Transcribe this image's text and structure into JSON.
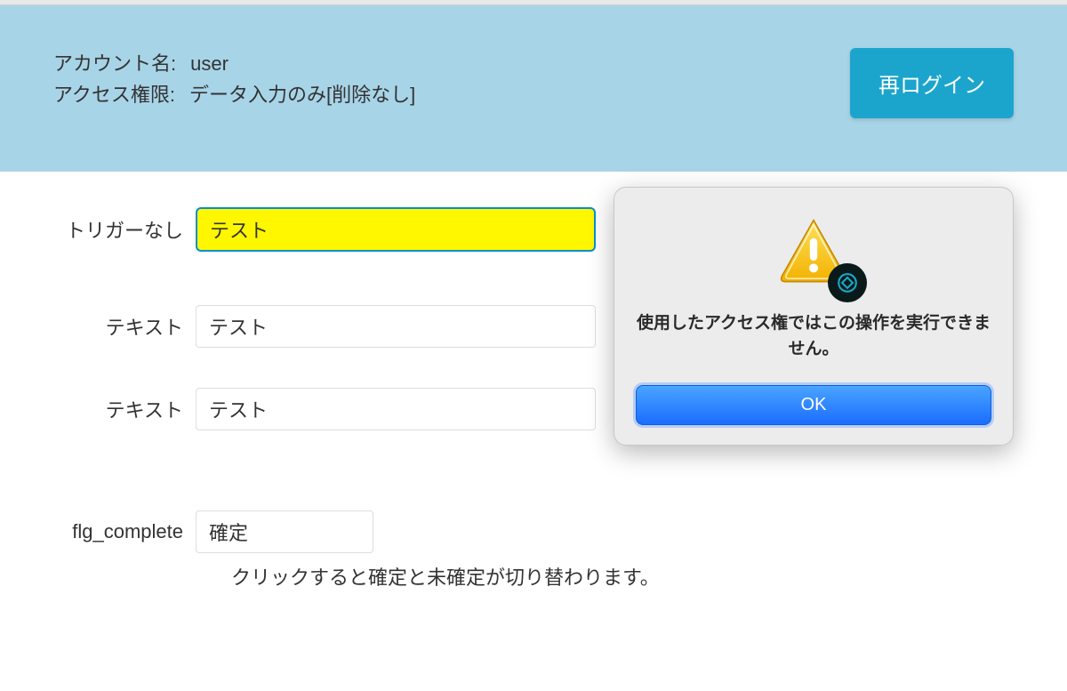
{
  "header": {
    "account_label": "アカウント名:",
    "account_value": "user",
    "access_label": "アクセス権限:",
    "access_value": "データ入力のみ[削除なし]",
    "relogin_label": "再ログイン"
  },
  "form": {
    "row1": {
      "label": "トリガーなし",
      "value": "テスト"
    },
    "row2": {
      "label": "テキスト",
      "value": "テスト"
    },
    "row3": {
      "label": "テキスト",
      "value": "テスト"
    },
    "row4": {
      "label": "flg_complete",
      "value": "確定"
    },
    "helper": "クリックすると確定と未確定が切り替わります。"
  },
  "dialog": {
    "message": "使用したアクセス権ではこの操作を実行できません。",
    "ok_label": "OK"
  }
}
